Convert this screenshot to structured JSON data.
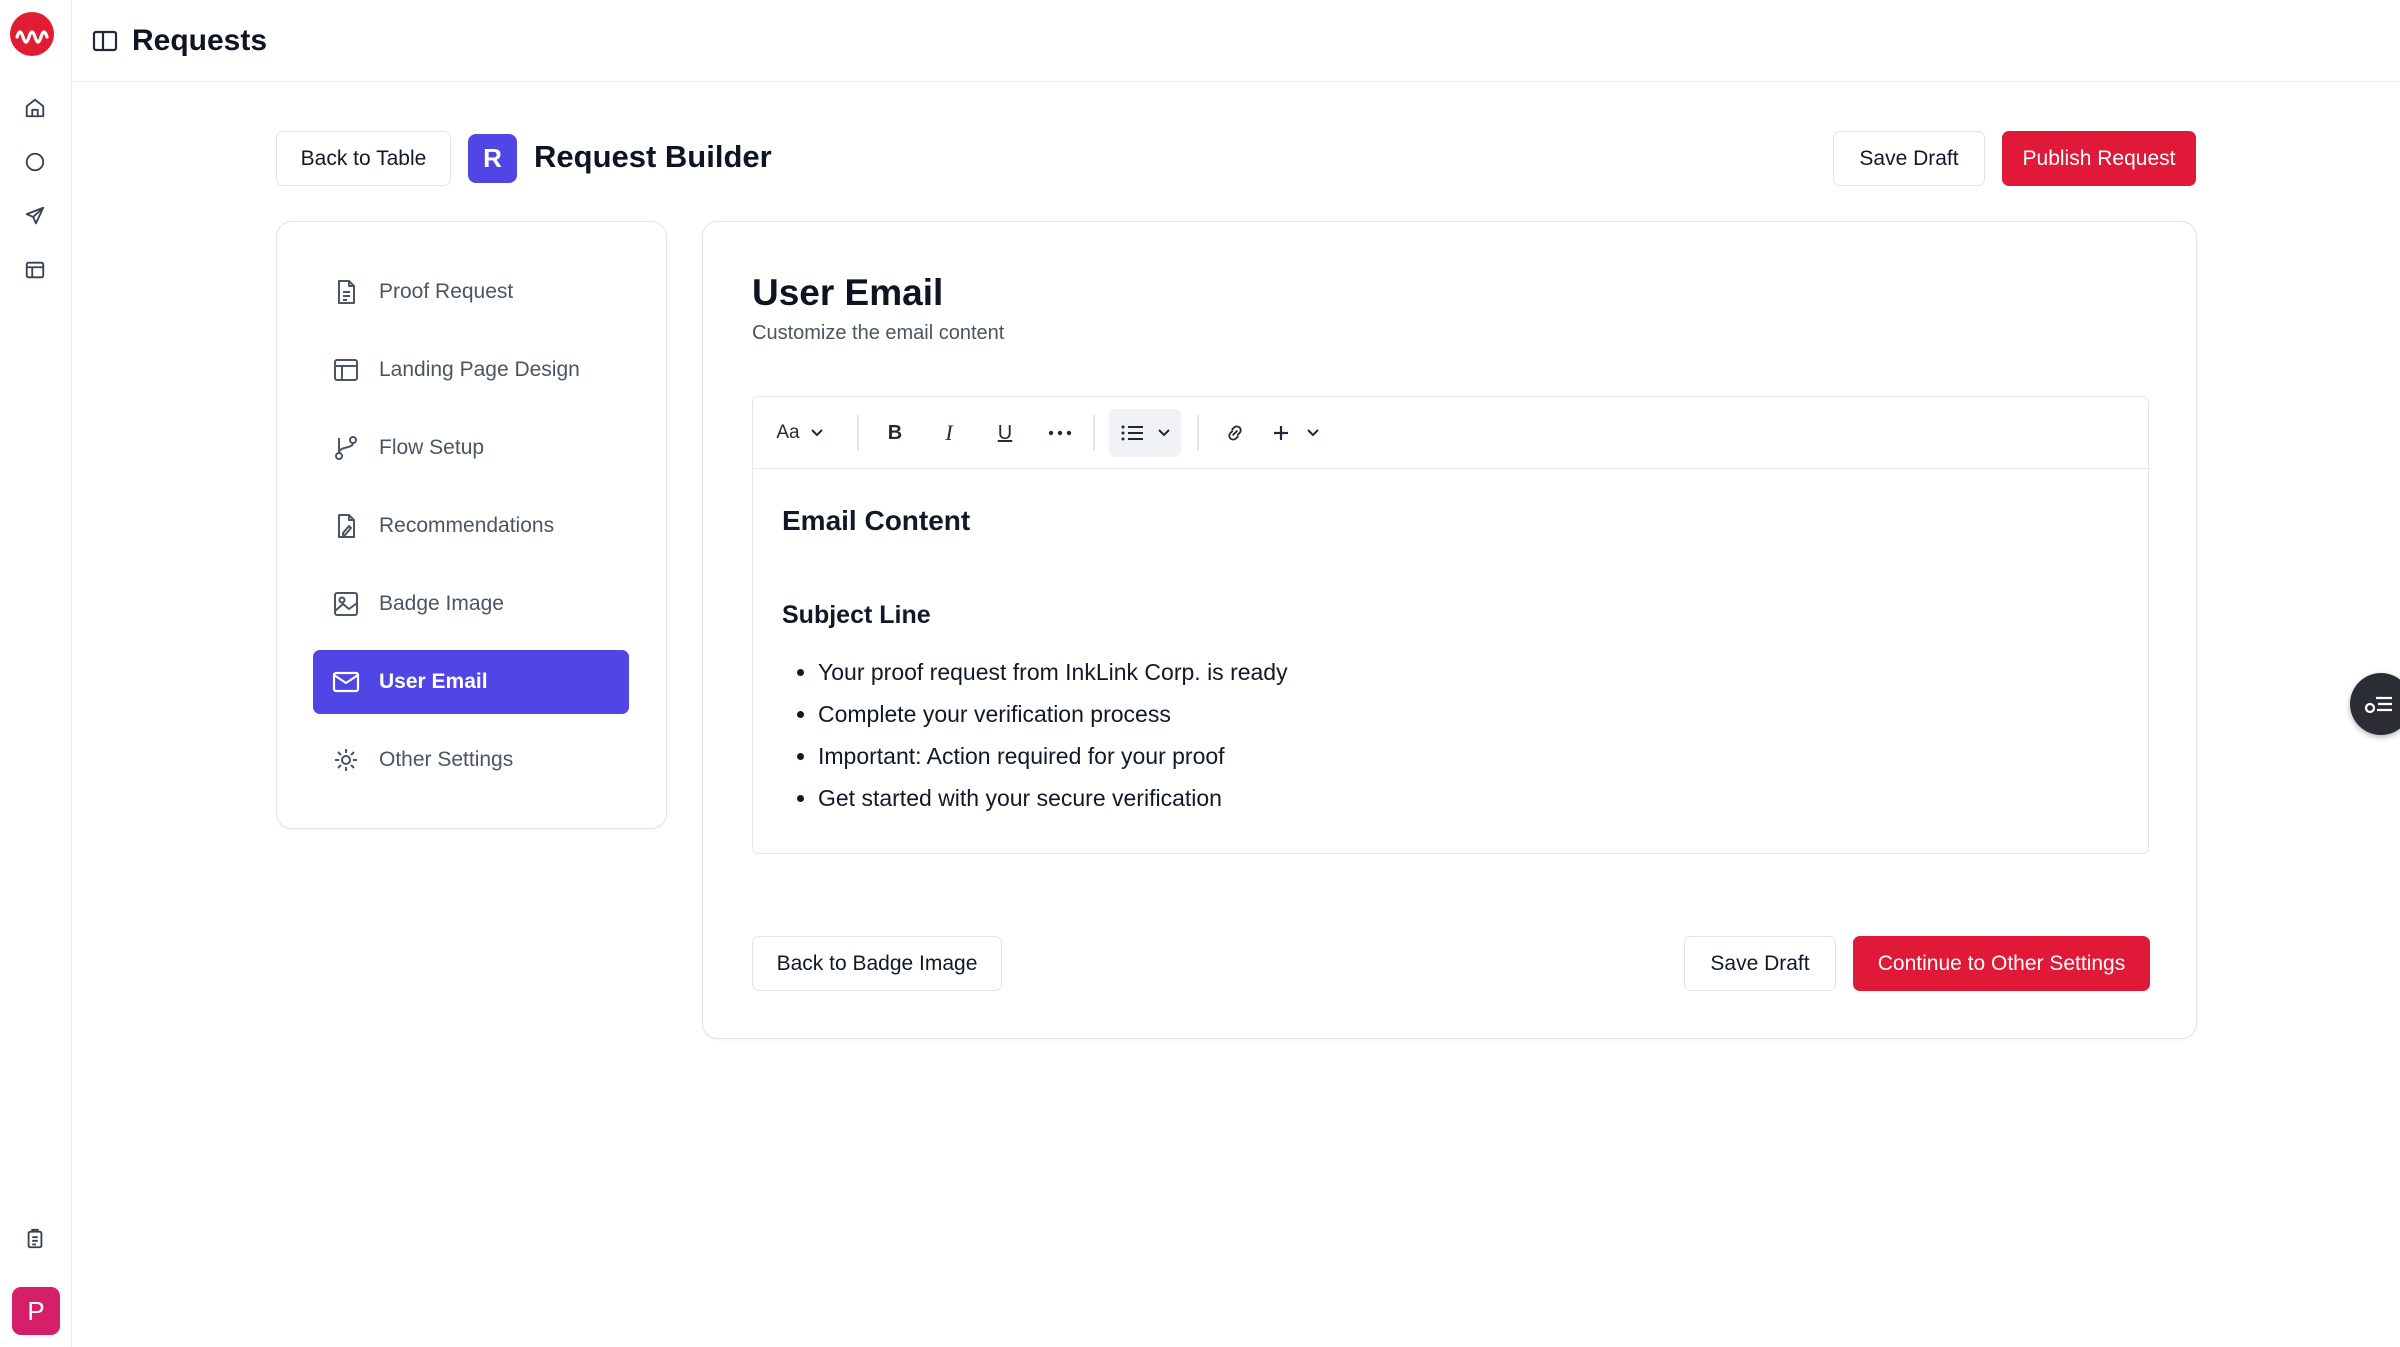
{
  "header": {
    "title": "Requests"
  },
  "rail": {
    "avatar_initial": "P"
  },
  "builder": {
    "back_label": "Back to Table",
    "badge_letter": "R",
    "title": "Request Builder",
    "save_draft_label": "Save Draft",
    "publish_label": "Publish Request"
  },
  "sidebar": {
    "items": [
      {
        "label": "Proof Request",
        "icon": "document-icon"
      },
      {
        "label": "Landing Page Design",
        "icon": "layout-icon"
      },
      {
        "label": "Flow Setup",
        "icon": "branch-icon"
      },
      {
        "label": "Recommendations",
        "icon": "file-edit-icon"
      },
      {
        "label": "Badge Image",
        "icon": "image-icon"
      },
      {
        "label": "User Email",
        "icon": "mail-icon",
        "active": true
      },
      {
        "label": "Other Settings",
        "icon": "gear-icon"
      }
    ]
  },
  "main": {
    "title": "User Email",
    "subtitle": "Customize the email content",
    "toolbar": {
      "font_label": "Aa",
      "bold": "B",
      "italic": "I",
      "underline": "U"
    },
    "content": {
      "heading": "Email Content",
      "subheading": "Subject Line",
      "bullets": [
        "Your proof request from InkLink Corp. is ready",
        "Complete your verification process",
        "Important: Action required for your proof",
        "Get started with your secure verification"
      ]
    },
    "back_label": "Back to Badge Image",
    "save_draft_label": "Save Draft",
    "continue_label": "Continue to Other Settings"
  },
  "colors": {
    "accent": "#df1937",
    "active": "#4f46e5",
    "avatar": "#d61f69"
  }
}
